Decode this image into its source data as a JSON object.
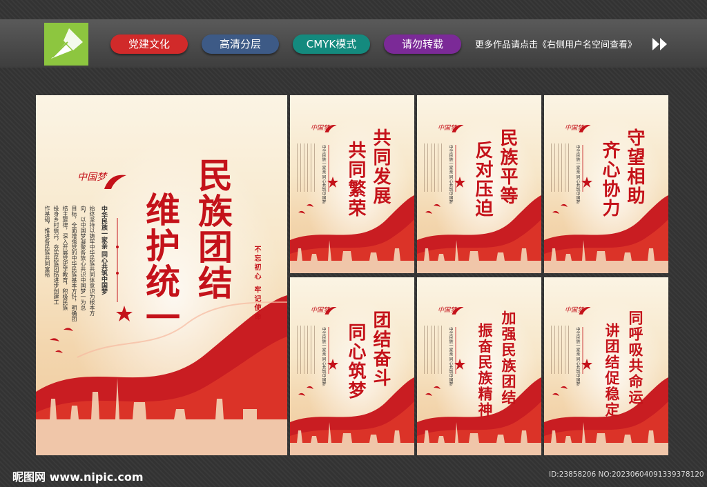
{
  "toolbar": {
    "tags": [
      {
        "label": "党建文化",
        "color": "#d12a2a"
      },
      {
        "label": "高清分层",
        "color": "#3d5a86"
      },
      {
        "label": "CMYK模式",
        "color": "#148a7e"
      },
      {
        "label": "请勿转载",
        "color": "#7b2a97"
      }
    ],
    "note": "更多作品请点击《右侧用户名空间查看》"
  },
  "main_poster": {
    "title_col1": "民族团结",
    "title_col2": "维护统一",
    "brand": "中国梦",
    "subtitle": "中华民族一家亲 同心共筑中国梦",
    "body": [
      "始终坚持以铸牢中华民族共同体意识为根本方",
      "向，以中国梦凝聚各族心共识中国梦一为总",
      "目标，全面增强党的中华民族基本方针，明确团",
      "结主旋律，深入开展党史学教育，积极民族",
      "投身乡村振兴，夯实民族团结进步创建工",
      "作基础，推进各民族共同富裕"
    ],
    "slogan": "不忘初心 牢记使命"
  },
  "small_posters": [
    {
      "line1": "共同发展",
      "line2": "共同繁荣"
    },
    {
      "line1": "民族平等",
      "line2": "反对压迫"
    },
    {
      "line1": "守望相助",
      "line2": "齐心协力"
    },
    {
      "line1": "团结奋斗",
      "line2": "同心筑梦"
    },
    {
      "line1": "加强民族团结",
      "line2": "振奋民族精神"
    },
    {
      "line1": "同呼吸共命运",
      "line2": "讲团结促稳定"
    }
  ],
  "small_poster_subtitle": "中华民族一家亲 同心共筑中国梦",
  "small_poster_brand": "中国梦",
  "footer": {
    "site": "昵图网 www.nipic.com",
    "id": "ID:23858206 NO:20230604091339378120"
  },
  "colors": {
    "accent_red": "#c4121a",
    "logo_green": "#8dc63f"
  }
}
